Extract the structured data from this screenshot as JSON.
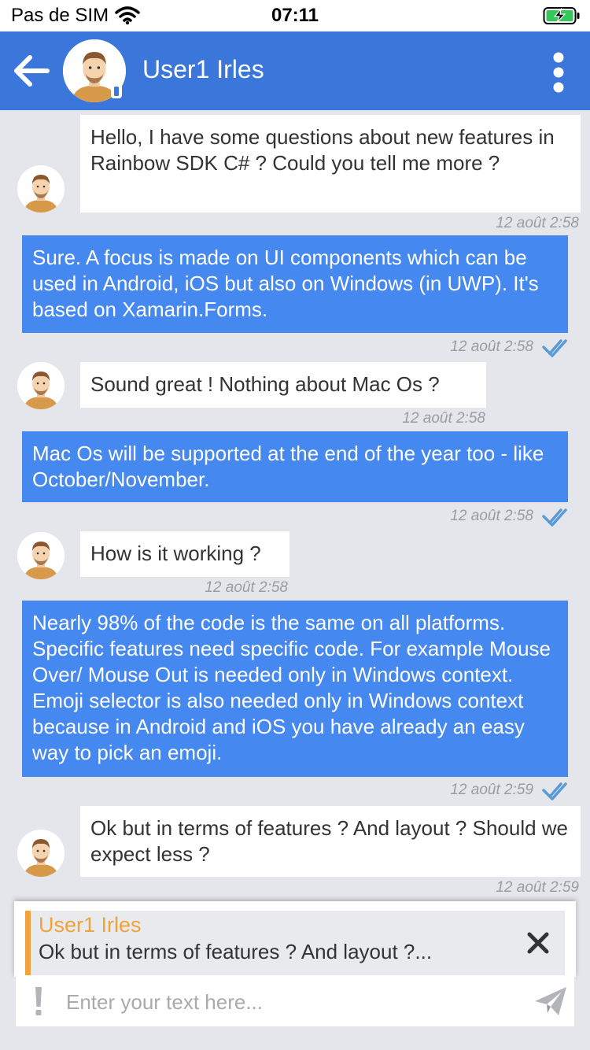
{
  "status_bar": {
    "carrier": "Pas de SIM",
    "time": "07:11",
    "battery_icon": "battery-charging-icon",
    "wifi_icon": "wifi-icon"
  },
  "header": {
    "title": "User1 Irles",
    "back_icon": "arrow-left-icon",
    "menu_icon": "more-vertical-icon",
    "background_color": "#3b77db"
  },
  "messages": [
    {
      "direction": "in",
      "text": "Hello, I have some questions about new features in Rainbow SDK C# ?  Could you tell me more ?",
      "timestamp": "12 août 2:58"
    },
    {
      "direction": "out",
      "text": "Sure. A focus is made on UI components which can be used in Android, iOS but also on Windows (in UWP). It's based on Xamarin.Forms.",
      "timestamp": "12 août 2:58",
      "read": true
    },
    {
      "direction": "in",
      "text": "Sound great ! Nothing about Mac Os ?",
      "timestamp": "12 août 2:58"
    },
    {
      "direction": "out",
      "text": "Mac Os will be supported at the end of the year too - like October/November.",
      "timestamp": "12 août 2:58",
      "read": true
    },
    {
      "direction": "in",
      "text": "How is it working ?",
      "timestamp": "12 août 2:58"
    },
    {
      "direction": "out",
      "text": "Nearly 98% of the code is the same on all platforms. Specific features need specific code. For example Mouse Over/ Mouse Out is needed only in Windows context. Emoji selector is also needed only in Windows context because in Android and iOS you have already an easy way to pick an emoji.",
      "timestamp": "12 août 2:59",
      "read": true
    },
    {
      "direction": "in",
      "text": "Ok but in terms of features ? And layout ? Should we expect less ?",
      "timestamp": "12 août 2:59"
    }
  ],
  "reply": {
    "name": "User1 Irles",
    "text": "Ok but in terms of features ? And layout ?...",
    "close_icon": "close-icon",
    "accent_color": "#f0a33c"
  },
  "composer": {
    "placeholder": "Enter your text here...",
    "urgency_icon": "exclamation-icon",
    "send_icon": "send-icon"
  },
  "colors": {
    "outgoing_bubble": "#4588f0",
    "incoming_bubble": "#ffffff",
    "chat_background": "#e5e6eb",
    "read_check": "#5b9bd5"
  }
}
